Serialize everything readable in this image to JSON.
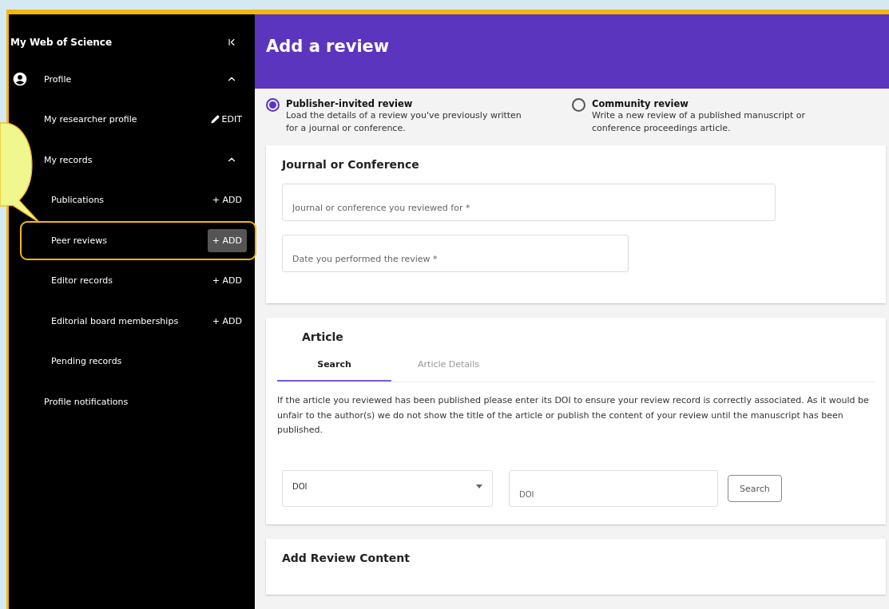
{
  "sidebar": {
    "title": "My Web of Science",
    "collapsed": false,
    "items": [
      {
        "label": "Profile",
        "expanded": true,
        "children": [
          {
            "label": "My researcher profile",
            "action": {
              "label": "EDIT",
              "kind": "edit",
              "hovered": false
            }
          },
          {
            "label": "My records",
            "expanded": true,
            "children": [
              {
                "label": "Publications",
                "action": {
                  "label": "+ ADD",
                  "kind": "add",
                  "hovered": false
                },
                "annotated": false
              },
              {
                "label": "Peer reviews",
                "action": {
                  "label": "+ ADD",
                  "kind": "add",
                  "hovered": true
                },
                "annotated": true
              },
              {
                "label": "Editor records",
                "action": {
                  "label": "+ ADD",
                  "kind": "add",
                  "hovered": false
                },
                "annotated": false
              },
              {
                "label": "Editorial board memberships",
                "action": {
                  "label": "+ ADD",
                  "kind": "add",
                  "hovered": false
                },
                "annotated": false
              },
              {
                "label": "Pending records",
                "annotated": false
              }
            ]
          },
          {
            "label": "Profile notifications"
          }
        ]
      }
    ]
  },
  "header": {
    "title": "Add a review"
  },
  "review_types": [
    {
      "title": "Publisher-invited review",
      "description": "Load the details of a review you've previously written for a journal or conference.",
      "selected": true
    },
    {
      "title": "Community review",
      "description": "Write a new review of a published manuscript or conference proceedings article.",
      "selected": false
    }
  ],
  "journal_card": {
    "title": "Journal or Conference",
    "fields": [
      {
        "placeholder": "Journal or conference you reviewed for *",
        "wide": true
      },
      {
        "placeholder": "Date you performed the review *",
        "wide": false
      }
    ]
  },
  "article_card": {
    "title": "Article",
    "tabs": [
      {
        "label": "Search",
        "selected": true
      },
      {
        "label": "Article Details",
        "selected": false
      }
    ],
    "info": "If the article you reviewed has been published please enter its DOI to ensure your review record is correctly associated. As it would be unfair to the author(s) we do not show the title of the article or publish the content of your review until the manuscript has been published.",
    "id_type": "DOI",
    "id_placeholder": "DOI",
    "search_button": "Search"
  },
  "content_card": {
    "title": "Add Review Content"
  }
}
